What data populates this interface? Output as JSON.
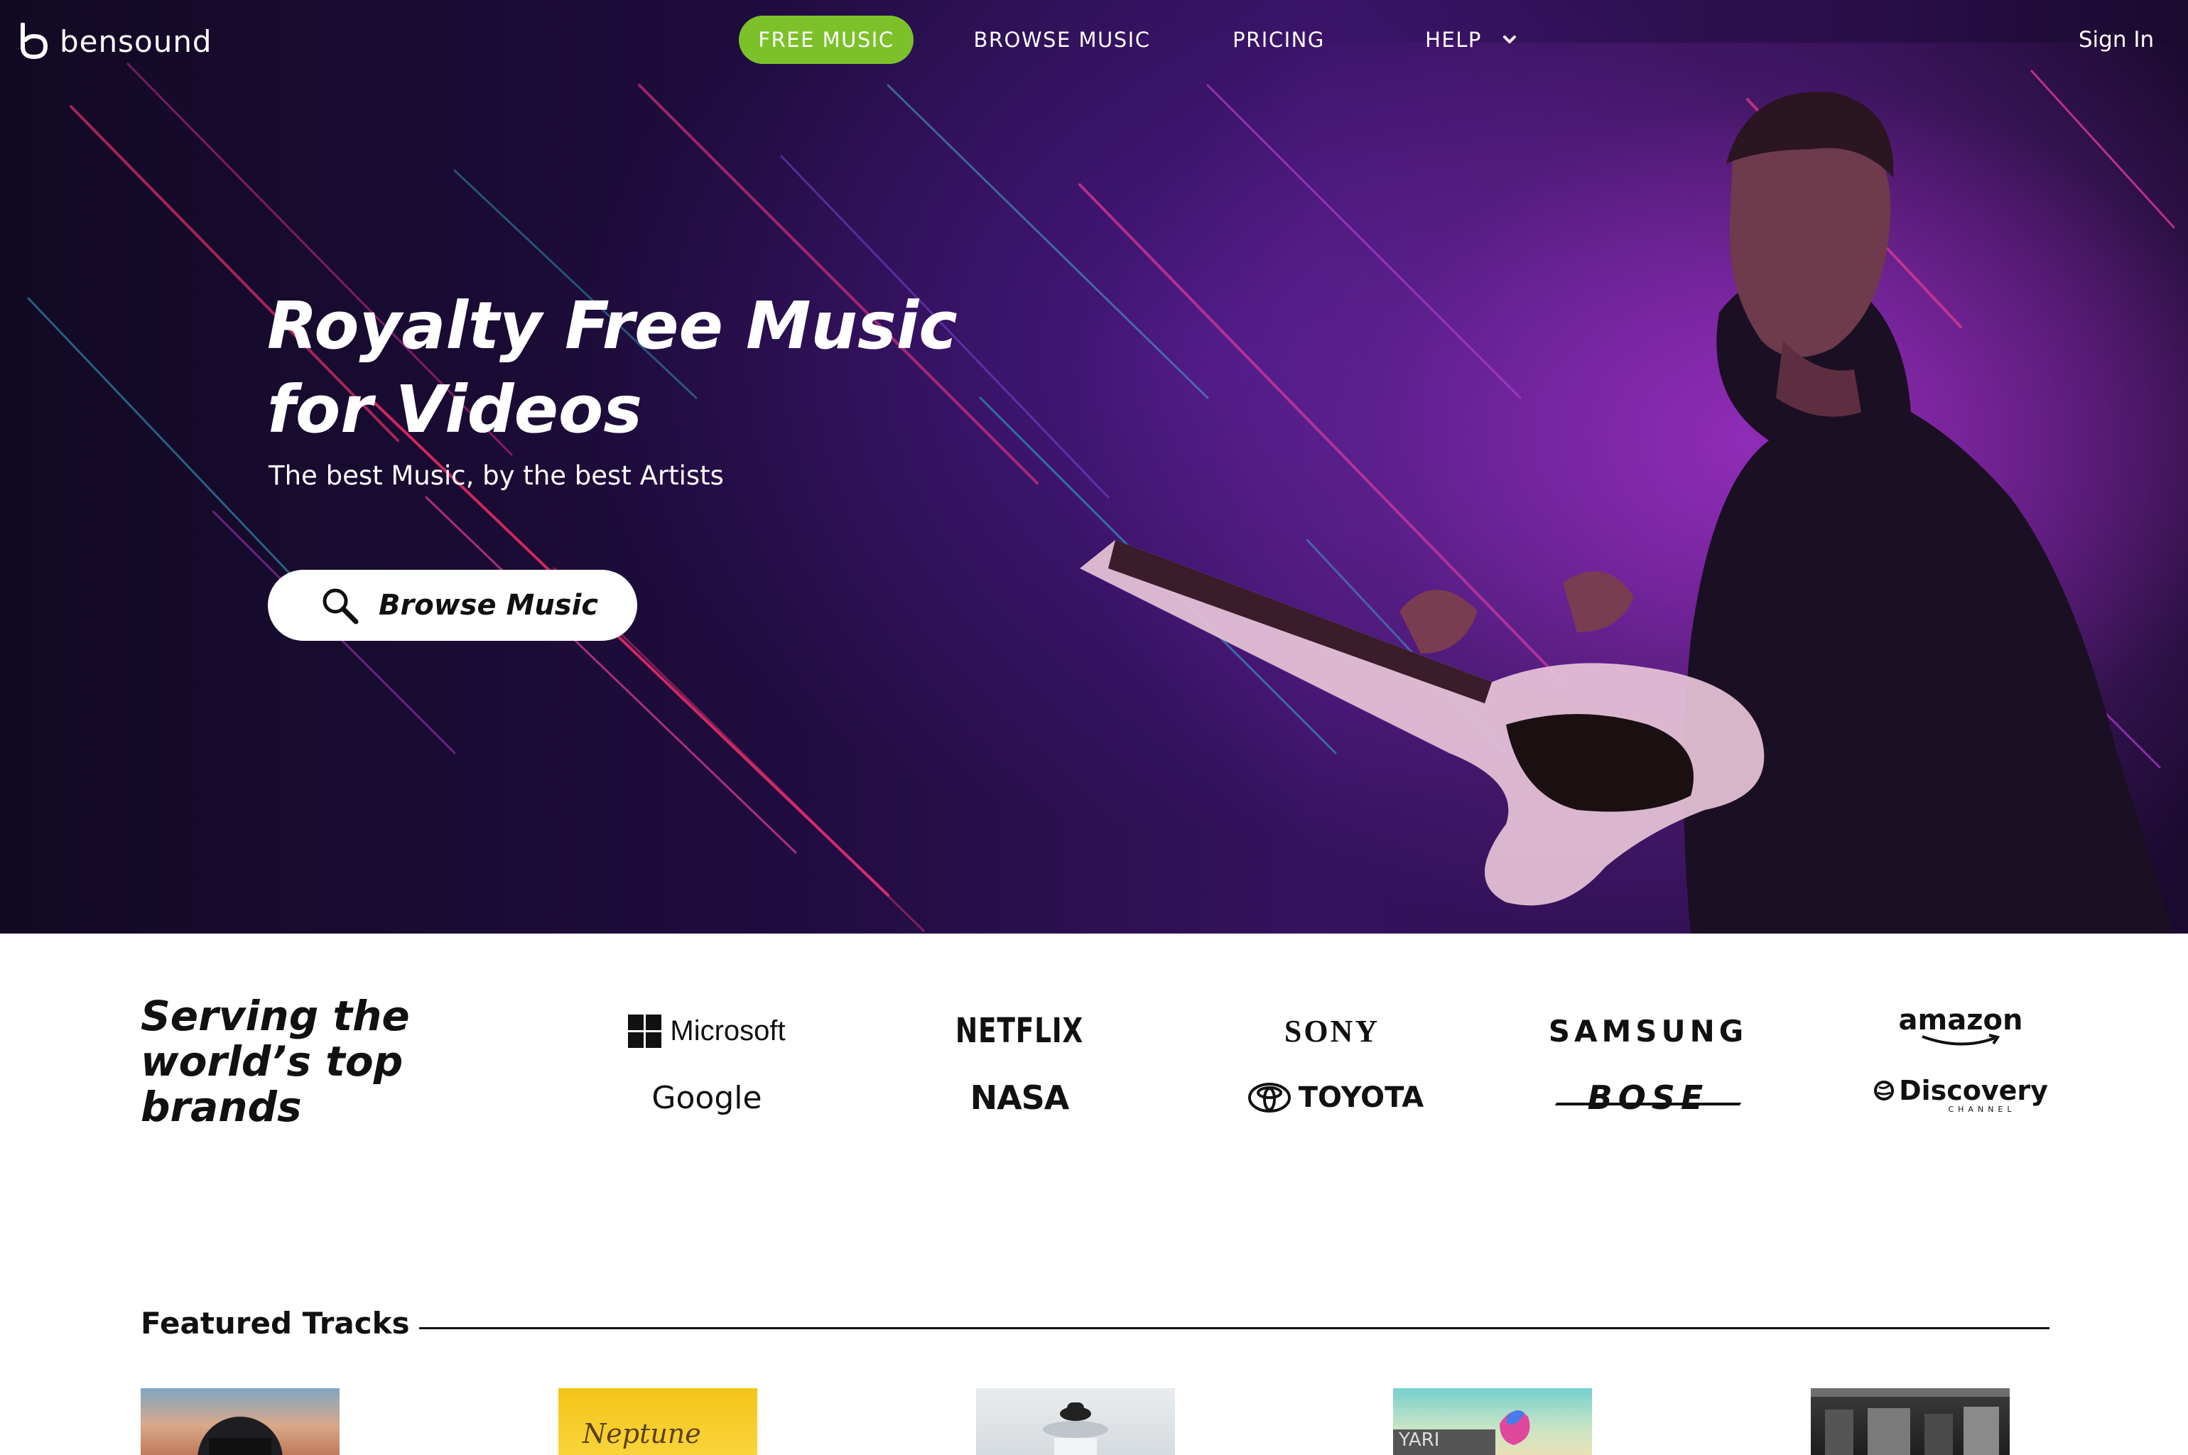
{
  "brand": {
    "name": "bensound"
  },
  "nav": {
    "free_music": "FREE MUSIC",
    "browse_music": "BROWSE MUSIC",
    "pricing": "PRICING",
    "help": "HELP",
    "sign_in": "Sign In"
  },
  "hero": {
    "title_line1": "Royalty Free Music",
    "title_line2": "for Videos",
    "subtitle": "The best Music, by the best Artists",
    "cta_label": "Browse Music"
  },
  "brands": {
    "title_line1": "Serving the",
    "title_line2": "world’s top",
    "title_line3": "brands",
    "logos": [
      "Microsoft",
      "NETFLIX",
      "SONY",
      "SAMSUNG",
      "amazon",
      "Google",
      "NASA",
      "TOYOTA",
      "BOSE",
      "Discovery"
    ],
    "discovery_sub": "CHANNEL"
  },
  "featured": {
    "title": "Featured Tracks",
    "track2_text": "Neptune",
    "track4_text": "YARI"
  },
  "colors": {
    "accent_green": "#7cc12a",
    "hero_purple": "#35125e"
  }
}
